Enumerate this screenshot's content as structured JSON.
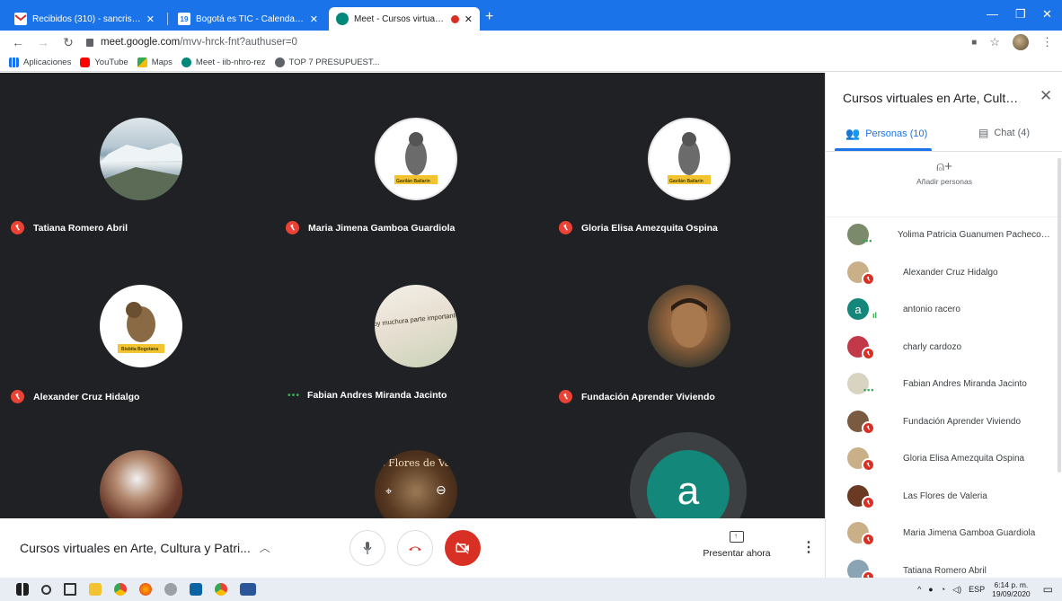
{
  "browser": {
    "tabs": [
      {
        "label": "Recibidos (310) - sancristobal@s",
        "active": false
      },
      {
        "label": "Bogotá es TIC - Calendar - sábad",
        "active": false
      },
      {
        "label": "Meet - Cursos virtuales en A",
        "active": true
      }
    ],
    "calendar_day": "19",
    "new_tab": "+",
    "url_host": "meet.google.com",
    "url_path": "/mvv-hrck-fnt?authuser=0",
    "bookmarks": [
      "Aplicaciones",
      "YouTube",
      "Maps",
      "Meet - iib-nhro-rez",
      "TOP 7 PRESUPUEST..."
    ]
  },
  "grid": {
    "tiles": [
      {
        "name": "Tatiana Romero Abril",
        "status": "muted",
        "pic": "glacier"
      },
      {
        "name": "Maria Jimena Gamboa Guardiola",
        "status": "muted",
        "pic": "bird",
        "caption": "Gavilán Bailarín"
      },
      {
        "name": "Gloria Elisa Amezquita Ospina",
        "status": "muted",
        "pic": "bird",
        "caption": "Gavilán Bailarín"
      },
      {
        "name": "Alexander Cruz Hidalgo",
        "status": "muted",
        "pic": "bisbita",
        "caption": "Bisbita Bogotana"
      },
      {
        "name": "Fabian Andres Miranda Jacinto",
        "status": "speaking",
        "pic": "sign",
        "caption": "hoy muchura parte importante de la magia"
      },
      {
        "name": "Fundación Aprender Viviendo",
        "status": "muted",
        "pic": "face"
      },
      {
        "name": "",
        "status": "",
        "pic": "stage"
      },
      {
        "name": "",
        "status": "",
        "pic": "flores",
        "caption": "s Flores de Valer"
      },
      {
        "name": "",
        "status": "",
        "pic": "letter",
        "letter": "a"
      }
    ]
  },
  "controls": {
    "meeting_title": "Cursos virtuales en Arte, Cultura y Patri...",
    "present_label": "Presentar ahora"
  },
  "panel": {
    "title": "Cursos virtuales en Arte, Cultura ...",
    "tab_people": "Personas (10)",
    "tab_chat": "Chat (4)",
    "add_people": "Añadir personas",
    "participants": [
      {
        "name": "Yolima Patricia Guanumen Pacheco S...",
        "avatar": "photo",
        "color": "#7a8a6a",
        "status": "speaking"
      },
      {
        "name": "Alexander Cruz Hidalgo",
        "avatar": "photo",
        "color": "#c9b089",
        "status": "muted"
      },
      {
        "name": "antonio racero",
        "avatar": "letter",
        "letter": "a",
        "status": "active"
      },
      {
        "name": "charly cardozo",
        "avatar": "photo",
        "color": "#c23a4a",
        "status": "muted"
      },
      {
        "name": "Fabian Andres Miranda Jacinto",
        "avatar": "photo",
        "color": "#d9d3c2",
        "status": "speaking"
      },
      {
        "name": "Fundación Aprender Viviendo",
        "avatar": "photo",
        "color": "#7a5a40",
        "status": "muted"
      },
      {
        "name": "Gloria Elisa Amezquita Ospina",
        "avatar": "photo",
        "color": "#c9b089",
        "status": "muted"
      },
      {
        "name": "Las Flores de Valeria",
        "avatar": "photo",
        "color": "#6a3a22",
        "status": "muted"
      },
      {
        "name": "Maria Jimena Gamboa Guardiola",
        "avatar": "photo",
        "color": "#c9b089",
        "status": "muted"
      },
      {
        "name": "Tatiana Romero Abril",
        "avatar": "photo",
        "color": "#8aa4b5",
        "status": "muted"
      }
    ]
  },
  "taskbar": {
    "lang": "ESP",
    "time": "6:14 p. m.",
    "date": "19/09/2020"
  },
  "colors": {
    "meet_bg": "#202124",
    "accent": "#1a73e8",
    "muted_red": "#d93025",
    "speaking_green": "#34a853",
    "letter_avatar": "#12877a"
  }
}
